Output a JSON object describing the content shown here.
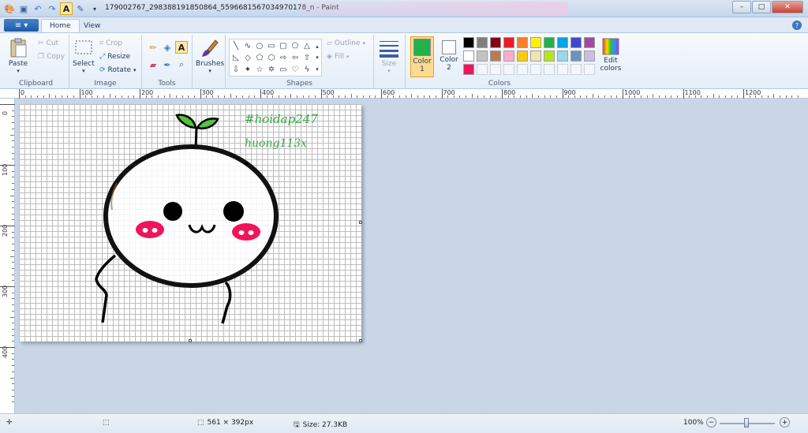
{
  "window": {
    "title": "179002767_298388191850864_5596681567034970178_n - Paint",
    "minimize_glyph": "–",
    "maximize_glyph": "□",
    "close_glyph": "✕"
  },
  "tabs": {
    "menu_glyph": "≡ ▾",
    "home": "Home",
    "view": "View",
    "help_glyph": "?"
  },
  "clipboard": {
    "paste": "Paste",
    "cut": "Cut",
    "copy": "Copy",
    "group": "Clipboard"
  },
  "image": {
    "select": "Select",
    "crop": "Crop",
    "resize": "Resize",
    "rotate": "Rotate",
    "group": "Image"
  },
  "tools": {
    "group": "Tools",
    "text_tool_glyph": "A"
  },
  "brushes": {
    "label": "Brushes"
  },
  "shapes": {
    "outline": "Outline",
    "fill": "Fill",
    "group": "Shapes"
  },
  "size": {
    "label": "Size"
  },
  "colors": {
    "color1": "Color\n1",
    "color1_a": "Color",
    "color1_b": "1",
    "color2_a": "Color",
    "color2_b": "2",
    "edit_a": "Edit",
    "edit_b": "colors",
    "group": "Colors",
    "color1_hex": "#22b14c",
    "color2_hex": "#ffffff",
    "palette_row1": [
      "#000000",
      "#7f7f7f",
      "#880015",
      "#ed1c24",
      "#ff7f27",
      "#fff200",
      "#22b14c",
      "#00a2e8",
      "#3f48cc",
      "#a349a4"
    ],
    "palette_row2": [
      "#ffffff",
      "#c3c3c3",
      "#b97a57",
      "#ffaec9",
      "#ffc90e",
      "#efe4b0",
      "#b5e61d",
      "#99d9ea",
      "#7092be",
      "#c8bfe7"
    ],
    "palette_row3": [
      "#f0145a",
      "",
      "",
      "",
      "",
      "",
      "",
      "",
      "",
      ""
    ]
  },
  "ruler": {
    "h_labels": [
      "0",
      "100",
      "200",
      "300",
      "400",
      "500",
      "600",
      "700",
      "800",
      "900",
      "1000",
      "1100",
      "1200"
    ],
    "v_labels": [
      "0",
      "100",
      "200",
      "300",
      "400"
    ]
  },
  "canvas": {
    "hashtag": "#hoidap247",
    "username": "huong113x",
    "text_color": "#3aa84a",
    "sprout_color": "#4fc43c",
    "cheek_color": "#f0145a"
  },
  "status": {
    "dimensions": "561 × 392px",
    "size": "Size: 27.3KB",
    "zoom": "100%",
    "zoom_out": "−",
    "zoom_in": "+"
  }
}
